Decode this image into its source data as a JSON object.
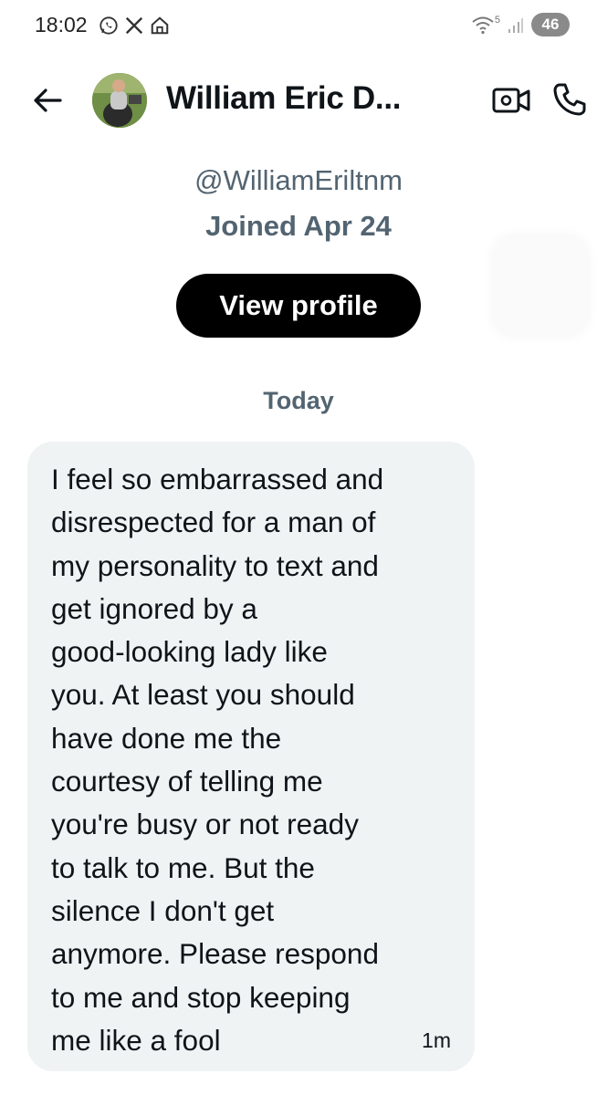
{
  "status_bar": {
    "time": "18:02",
    "battery": "46",
    "signal_badge": "5",
    "icons": [
      "whatsapp-icon",
      "x-logo-icon",
      "home-app-icon",
      "wifi-icon",
      "signal-icon",
      "battery-icon"
    ]
  },
  "header": {
    "title": "William Eric D...",
    "icons": [
      "back-arrow-icon",
      "video-call-icon",
      "phone-icon"
    ]
  },
  "profile": {
    "handle": "@WilliamEriltnm",
    "joined": "Joined Apr 24",
    "view_profile_label": "View profile"
  },
  "conversation": {
    "date_label": "Today",
    "messages": [
      {
        "text": "I feel so embarrassed and\ndisrespected for a man of\nmy personality to text and\nget ignored by a\ngood-looking lady like\nyou. At least you should\nhave done me the\ncourtesy of telling me\nyou're busy or not ready\nto talk to me. But the\nsilence I don't get\nanymore. Please respond\nto me and stop keeping\nme like a fool",
        "time": "1m"
      }
    ]
  },
  "colors": {
    "bubble_bg": "#eff3f4",
    "secondary_text": "#536471",
    "primary_text": "#0f1419",
    "button_bg": "#000000"
  }
}
